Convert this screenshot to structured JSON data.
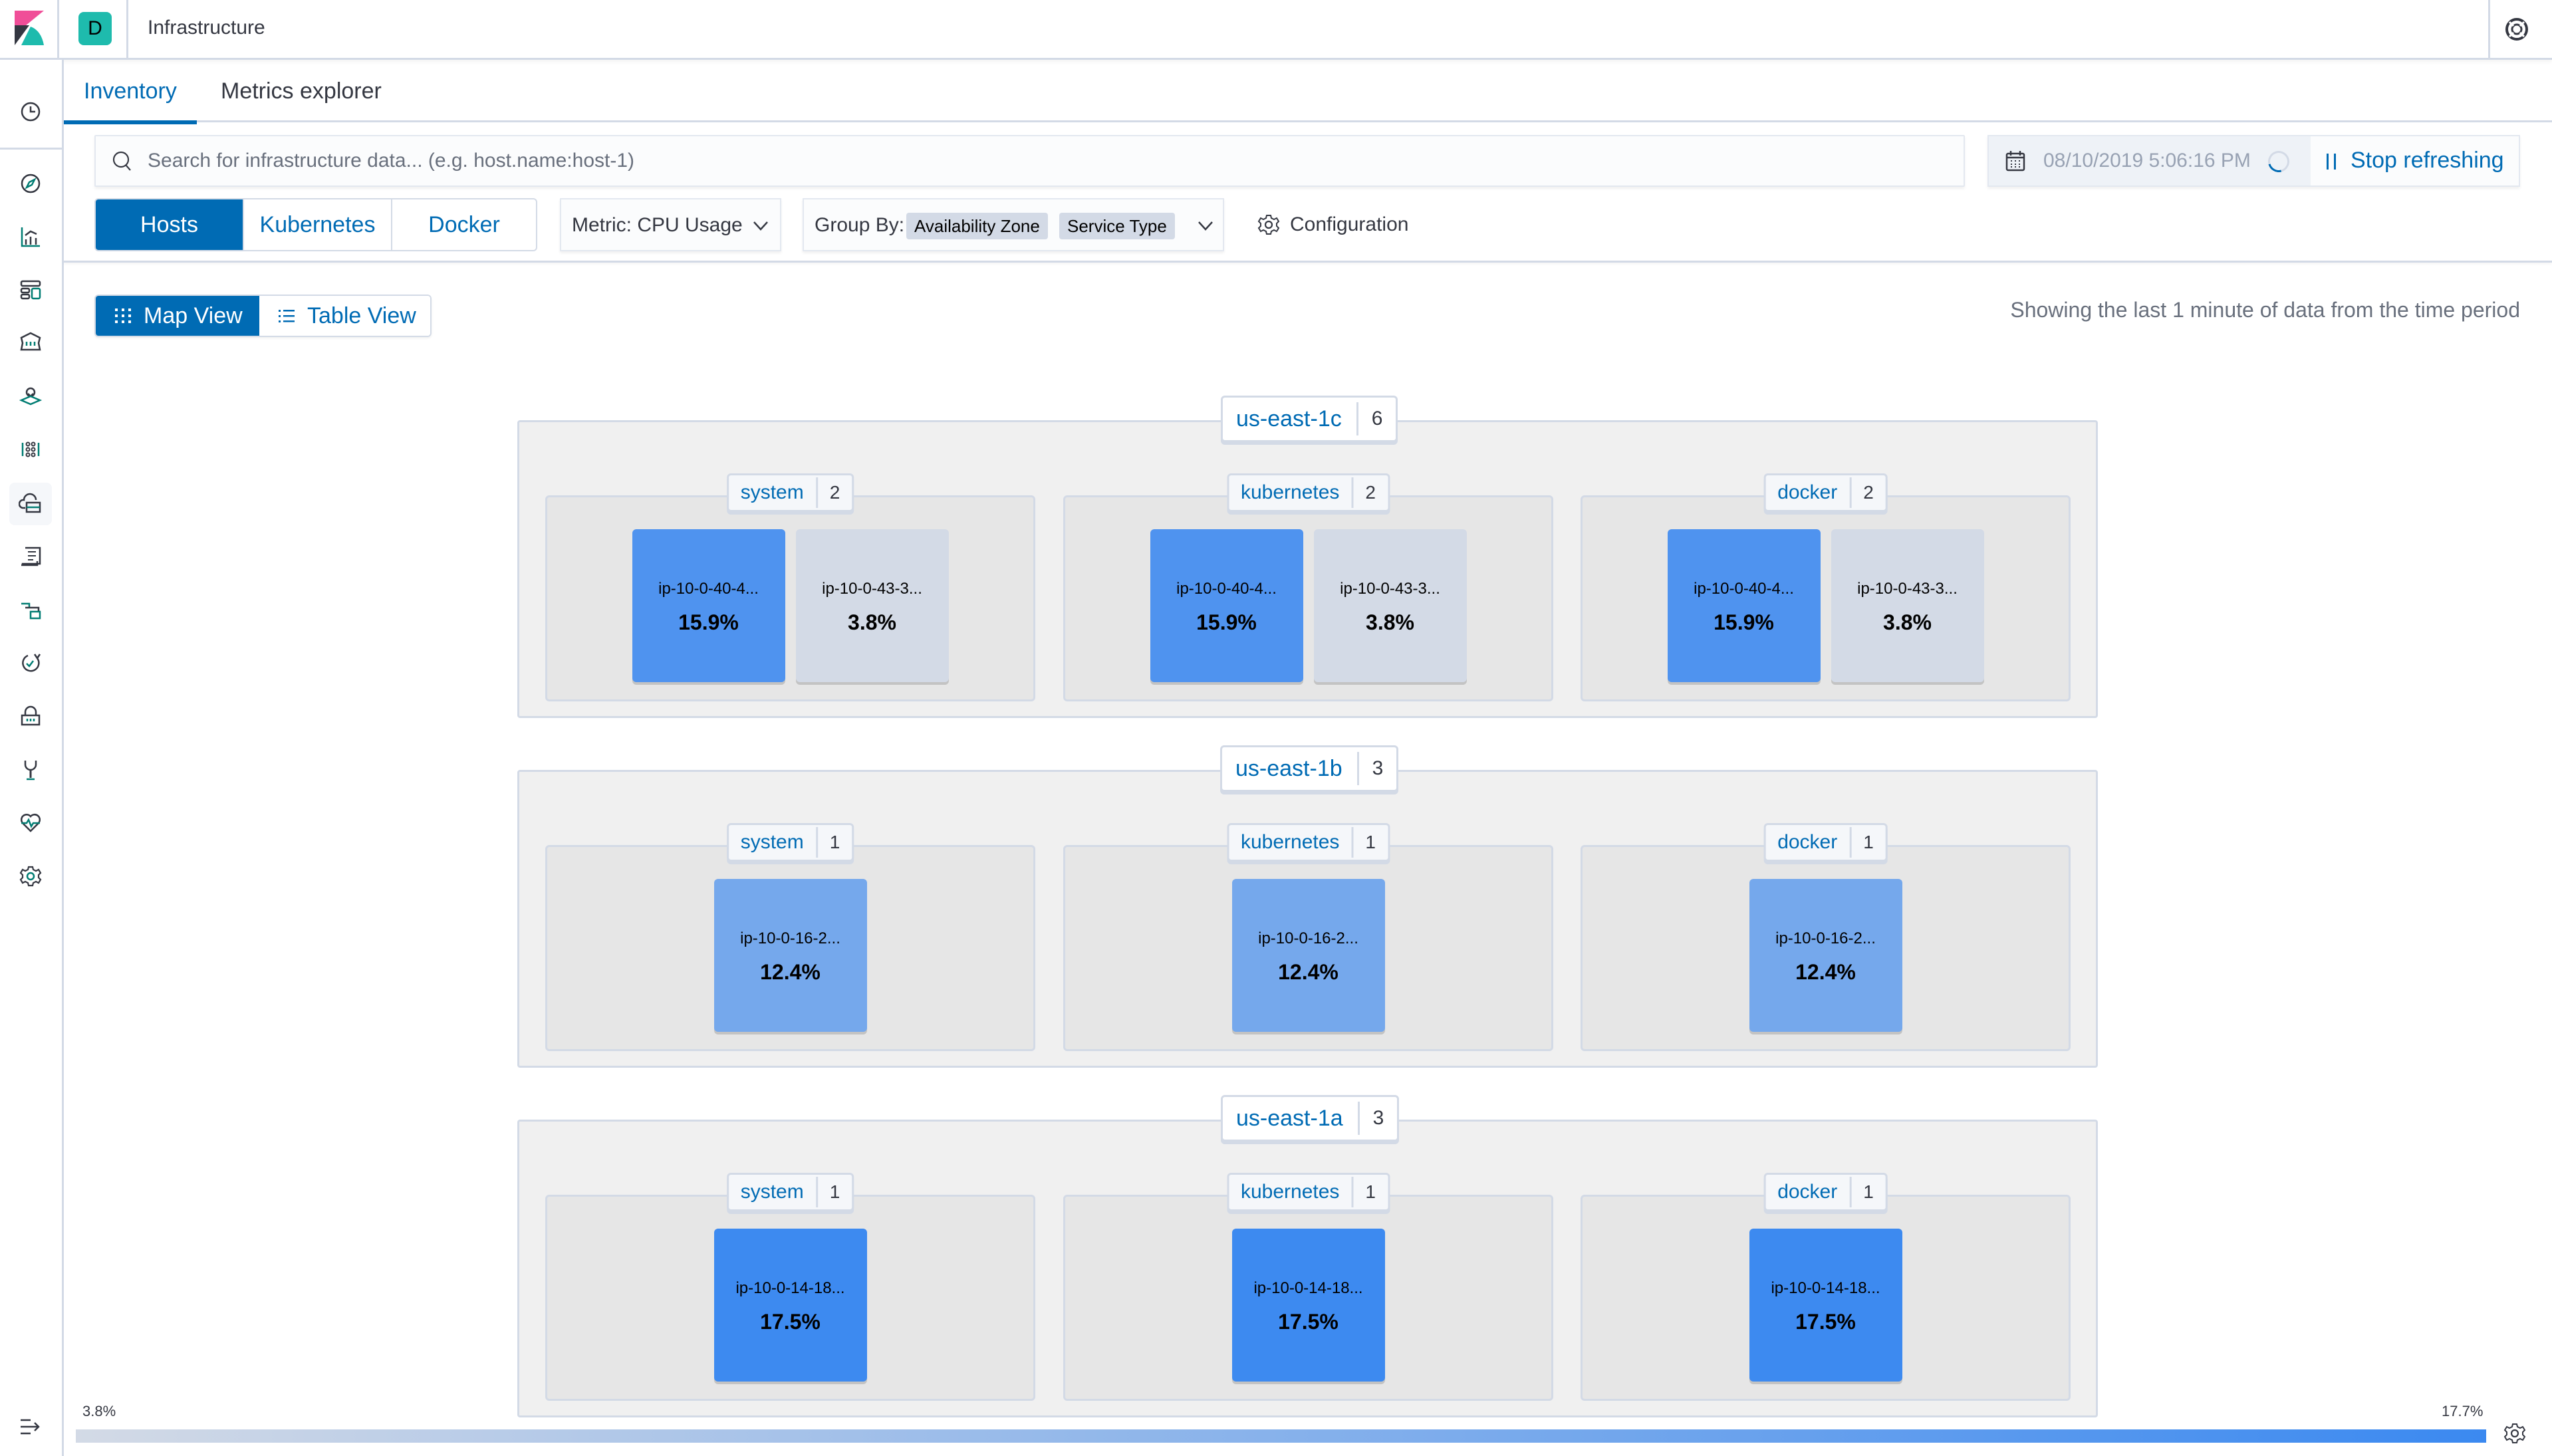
{
  "header": {
    "space_initial": "D",
    "app_title": "Infrastructure",
    "help_icon": "help-icon"
  },
  "sidebar": {
    "items": [
      {
        "name": "recently-viewed",
        "icon": "clock-icon"
      },
      {
        "name": "discover",
        "icon": "compass-icon"
      },
      {
        "name": "visualize",
        "icon": "visualize-icon"
      },
      {
        "name": "dashboard",
        "icon": "dashboard-icon"
      },
      {
        "name": "canvas",
        "icon": "canvas-icon"
      },
      {
        "name": "maps",
        "icon": "maps-icon"
      },
      {
        "name": "machine-learning",
        "icon": "ml-icon"
      },
      {
        "name": "infrastructure",
        "icon": "infrastructure-icon",
        "active": true
      },
      {
        "name": "logs",
        "icon": "logs-icon"
      },
      {
        "name": "apm",
        "icon": "apm-icon"
      },
      {
        "name": "uptime",
        "icon": "uptime-icon"
      },
      {
        "name": "siem",
        "icon": "siem-icon"
      },
      {
        "name": "dev-tools",
        "icon": "dev-tools-icon"
      },
      {
        "name": "stack-monitoring",
        "icon": "monitoring-icon"
      },
      {
        "name": "management",
        "icon": "gear-icon"
      }
    ],
    "collapse_icon": "collapse-menu-icon"
  },
  "tabs": [
    {
      "label": "Inventory",
      "active": true
    },
    {
      "label": "Metrics explorer",
      "active": false
    }
  ],
  "search": {
    "placeholder": "Search for infrastructure data... (e.g. host.name:host-1)",
    "value": ""
  },
  "datepicker": {
    "date": "08/10/2019 5:06:16 PM",
    "stop_label": "Stop refreshing"
  },
  "node_types": [
    {
      "label": "Hosts",
      "active": true
    },
    {
      "label": "Kubernetes",
      "active": false
    },
    {
      "label": "Docker",
      "active": false
    }
  ],
  "metric": {
    "label": "Metric: CPU Usage"
  },
  "group_by": {
    "label": "Group By:",
    "values": [
      "Availability Zone",
      "Service Type"
    ]
  },
  "configuration": {
    "label": "Configuration"
  },
  "view_toggle": [
    {
      "label": "Map View",
      "active": true
    },
    {
      "label": "Table View",
      "active": false
    }
  ],
  "showing_text": "Showing the last 1 minute of data from the time period",
  "colors": {
    "accent": "#006bb4",
    "node_high": "#3b89f0",
    "node_mid_high": "#4a90f2",
    "node_mid": "#6fa5ee",
    "node_low": "#d3dae6"
  },
  "zones": [
    {
      "name": "us-east-1c",
      "count": "6",
      "groups": [
        {
          "name": "system",
          "count": "2",
          "nodes": [
            {
              "name": "ip-10-0-40-4...",
              "value": "15.9%"
            },
            {
              "name": "ip-10-0-43-3...",
              "value": "3.8%"
            }
          ]
        },
        {
          "name": "kubernetes",
          "count": "2",
          "nodes": [
            {
              "name": "ip-10-0-40-4...",
              "value": "15.9%"
            },
            {
              "name": "ip-10-0-43-3...",
              "value": "3.8%"
            }
          ]
        },
        {
          "name": "docker",
          "count": "2",
          "nodes": [
            {
              "name": "ip-10-0-40-4...",
              "value": "15.9%"
            },
            {
              "name": "ip-10-0-43-3...",
              "value": "3.8%"
            }
          ]
        }
      ]
    },
    {
      "name": "us-east-1b",
      "count": "3",
      "groups": [
        {
          "name": "system",
          "count": "1",
          "nodes": [
            {
              "name": "ip-10-0-16-2...",
              "value": "12.4%"
            }
          ]
        },
        {
          "name": "kubernetes",
          "count": "1",
          "nodes": [
            {
              "name": "ip-10-0-16-2...",
              "value": "12.4%"
            }
          ]
        },
        {
          "name": "docker",
          "count": "1",
          "nodes": [
            {
              "name": "ip-10-0-16-2...",
              "value": "12.4%"
            }
          ]
        }
      ]
    },
    {
      "name": "us-east-1a",
      "count": "3",
      "groups": [
        {
          "name": "system",
          "count": "1",
          "nodes": [
            {
              "name": "ip-10-0-14-18...",
              "value": "17.5%"
            }
          ]
        },
        {
          "name": "kubernetes",
          "count": "1",
          "nodes": [
            {
              "name": "ip-10-0-14-18...",
              "value": "17.5%"
            }
          ]
        },
        {
          "name": "docker",
          "count": "1",
          "nodes": [
            {
              "name": "ip-10-0-14-18...",
              "value": "17.5%"
            }
          ]
        }
      ]
    }
  ],
  "legend": {
    "min": "3.8%",
    "max": "17.7%"
  }
}
